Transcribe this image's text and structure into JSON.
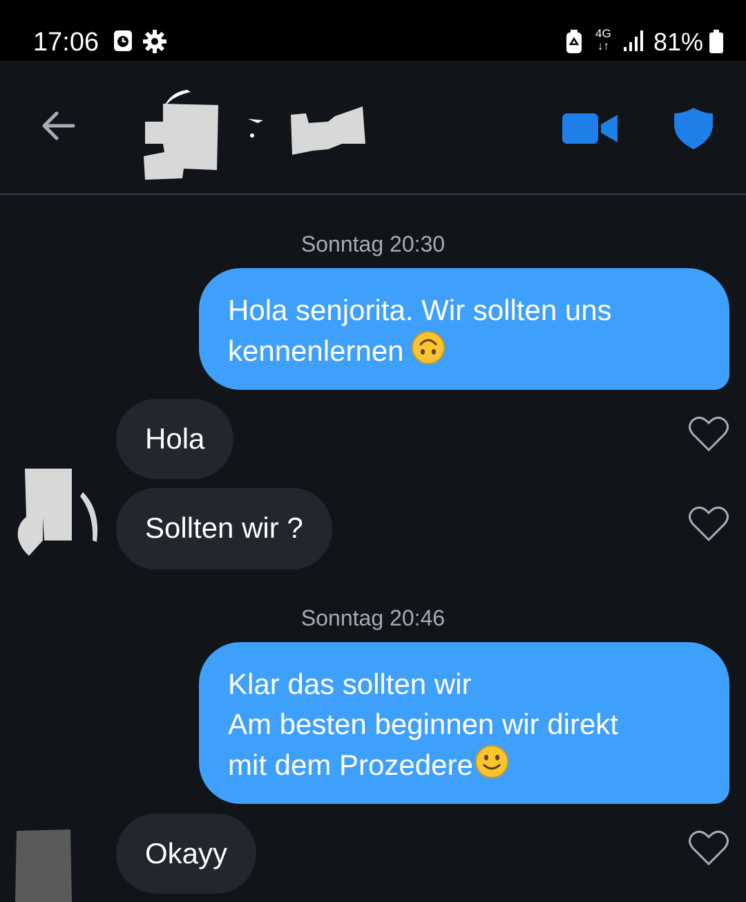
{
  "status_bar": {
    "time": "17:06",
    "icons": [
      "alarm-icon",
      "settings-gear-icon",
      "battery-saver-icon",
      "network-4g-icon",
      "signal-icon",
      "battery-icon"
    ],
    "network": "4G",
    "battery": "81%"
  },
  "header": {
    "back_icon": "arrow-left-icon",
    "video_icon": "video-call-icon",
    "safety_icon": "shield-icon",
    "accent_color": "#1f7fe8"
  },
  "messages": [
    {
      "type": "timestamp",
      "text": "Sonntag 20:30"
    },
    {
      "type": "sent",
      "lines": [
        "Hola senjorita. Wir sollten uns",
        "kennenlernen"
      ],
      "emoji": "upside-down-face"
    },
    {
      "type": "received",
      "text": "Hola"
    },
    {
      "type": "received",
      "text": "Sollten wir ?"
    },
    {
      "type": "timestamp",
      "text": "Sonntag 20:46"
    },
    {
      "type": "sent",
      "lines": [
        "Klar das sollten wir",
        "Am besten beginnen wir direkt",
        "mit dem Prozedere"
      ],
      "emoji": "slightly-smiling-face"
    },
    {
      "type": "received",
      "text": "Okayy"
    }
  ],
  "colors": {
    "background": "#111418",
    "sent_bubble": "#3fa0fb",
    "received_bubble": "#22262d",
    "timestamp_text": "#a6abb3"
  }
}
